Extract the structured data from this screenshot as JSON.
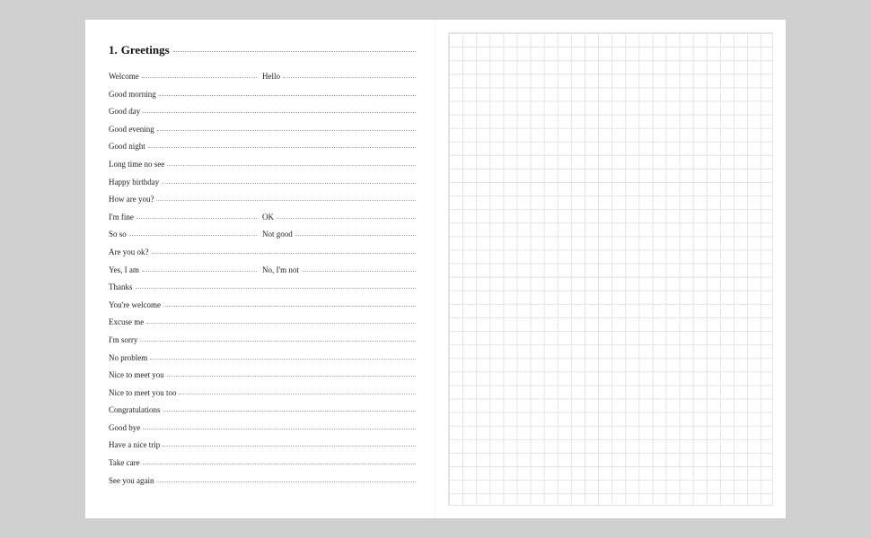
{
  "section": {
    "number": "1.",
    "title": "Greetings"
  },
  "rows": [
    {
      "cells": [
        "Welcome",
        "Hello"
      ]
    },
    {
      "cells": [
        "Good morning"
      ]
    },
    {
      "cells": [
        "Good day"
      ]
    },
    {
      "cells": [
        "Good evening"
      ]
    },
    {
      "cells": [
        "Good night"
      ]
    },
    {
      "cells": [
        "Long time no see"
      ]
    },
    {
      "cells": [
        "Happy birthday"
      ]
    },
    {
      "cells": [
        "How are you?"
      ]
    },
    {
      "cells": [
        "I'm fine",
        "OK"
      ]
    },
    {
      "cells": [
        "So so",
        "Not good"
      ]
    },
    {
      "cells": [
        "Are you ok?"
      ]
    },
    {
      "cells": [
        "Yes, I am",
        "No, I'm not"
      ]
    },
    {
      "cells": [
        "Thanks"
      ]
    },
    {
      "cells": [
        "You're welcome"
      ]
    },
    {
      "cells": [
        "Excuse me"
      ]
    },
    {
      "cells": [
        "I'm sorry"
      ]
    },
    {
      "cells": [
        "No problem"
      ]
    },
    {
      "cells": [
        "Nice to meet you"
      ]
    },
    {
      "cells": [
        "Nice to meet you too"
      ]
    },
    {
      "cells": [
        "Congratulations"
      ]
    },
    {
      "cells": [
        "Good bye"
      ]
    },
    {
      "cells": [
        "Have a nice trip"
      ]
    },
    {
      "cells": [
        "Take care"
      ]
    },
    {
      "cells": [
        "See you again"
      ]
    }
  ]
}
